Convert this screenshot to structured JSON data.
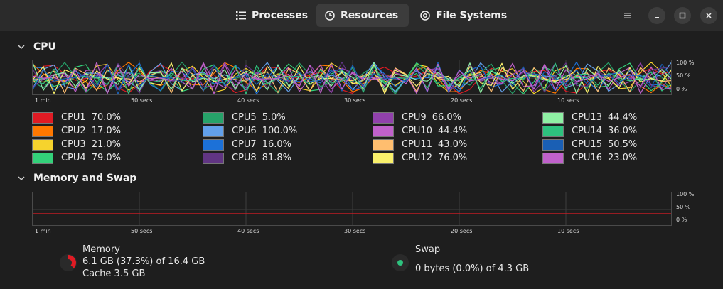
{
  "header": {
    "tabs": [
      {
        "label": "Processes",
        "icon": "list-icon",
        "active": false
      },
      {
        "label": "Resources",
        "icon": "gauge-icon",
        "active": true
      },
      {
        "label": "File Systems",
        "icon": "disk-icon",
        "active": false
      }
    ],
    "window_buttons": [
      "menu-icon",
      "minimize-icon",
      "maximize-icon",
      "close-icon"
    ]
  },
  "cpu": {
    "title": "CPU",
    "y_ticks": [
      "100 %",
      "50 %",
      "0 %"
    ],
    "x_ticks": [
      "1 min",
      "50 secs",
      "40 secs",
      "30 secs",
      "20 secs",
      "10 secs"
    ],
    "cores": [
      {
        "name": "CPU1",
        "value": "70.0%",
        "color": "#e01b24"
      },
      {
        "name": "CPU2",
        "value": "17.0%",
        "color": "#ff7800"
      },
      {
        "name": "CPU3",
        "value": "21.0%",
        "color": "#f6d32d"
      },
      {
        "name": "CPU4",
        "value": "79.0%",
        "color": "#33d17a"
      },
      {
        "name": "CPU5",
        "value": "5.0%",
        "color": "#26a269"
      },
      {
        "name": "CPU6",
        "value": "100.0%",
        "color": "#62a0ea"
      },
      {
        "name": "CPU7",
        "value": "16.0%",
        "color": "#1c71d8"
      },
      {
        "name": "CPU8",
        "value": "81.8%",
        "color": "#613583"
      },
      {
        "name": "CPU9",
        "value": "66.0%",
        "color": "#9141ac"
      },
      {
        "name": "CPU10",
        "value": "44.4%",
        "color": "#c061cb"
      },
      {
        "name": "CPU11",
        "value": "43.0%",
        "color": "#ffbe6f"
      },
      {
        "name": "CPU12",
        "value": "76.0%",
        "color": "#f9f06b"
      },
      {
        "name": "CPU13",
        "value": "44.4%",
        "color": "#8ff0a4"
      },
      {
        "name": "CPU14",
        "value": "36.0%",
        "color": "#2ec27e"
      },
      {
        "name": "CPU15",
        "value": "50.5%",
        "color": "#1a5fb4"
      },
      {
        "name": "CPU16",
        "value": "23.0%",
        "color": "#c061cb"
      }
    ]
  },
  "memory": {
    "title": "Memory and Swap",
    "y_ticks": [
      "100 %",
      "50 %",
      "0 %"
    ],
    "x_ticks": [
      "1 min",
      "50 secs",
      "40 secs",
      "30 secs",
      "20 secs",
      "10 secs"
    ],
    "memory_color": "#e01b24",
    "swap_color": "#2ec27e",
    "memory_fraction": 0.373,
    "swap_fraction": 0.0,
    "memory_label": "Memory",
    "memory_usage": "6.1 GB (37.3%) of 16.4 GB",
    "cache": "Cache 3.5 GB",
    "swap_label": "Swap",
    "swap_usage": "0 bytes (0.0%) of 4.3 GB"
  }
}
